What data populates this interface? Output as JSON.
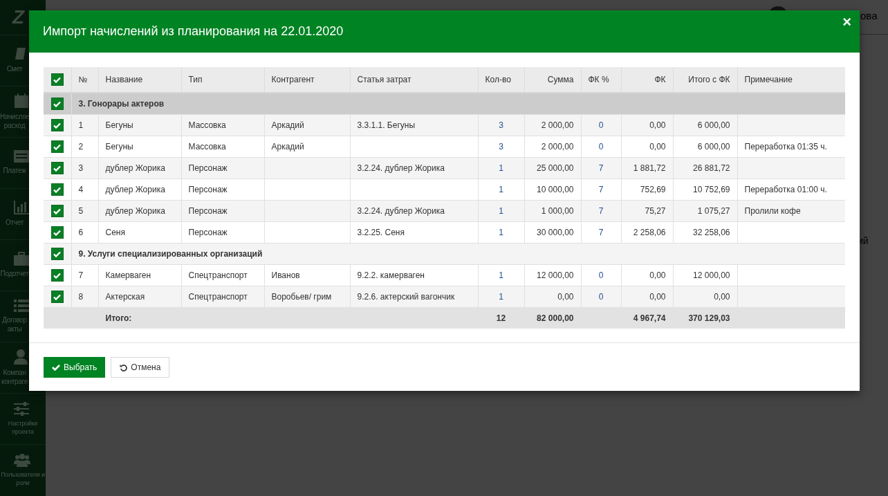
{
  "sidebar": {
    "logo": "Z",
    "items": [
      {
        "lines": [
          "Смет"
        ]
      },
      {
        "lines": [
          "Начисляе",
          "расход"
        ]
      },
      {
        "lines": [
          "Платеж"
        ]
      },
      {
        "lines": [
          "Отчет"
        ]
      },
      {
        "lines": [
          "Подотчет"
        ]
      },
      {
        "lines": [
          "Договор",
          "акты"
        ]
      },
      {
        "lines": [
          "Компан",
          "контраге"
        ]
      },
      {
        "lines": [
          "Настройки",
          "проекта"
        ]
      },
      {
        "lines": [
          "Пользователи и",
          "роли"
        ]
      }
    ]
  },
  "top_bar": {
    "user_name": "ова"
  },
  "background": {
    "hint": "ий"
  },
  "dialog": {
    "title": "Импорт начислений из планирования на 22.01.2020",
    "close": "×",
    "table": {
      "header_checked": true,
      "columns": [
        "№",
        "Название",
        "Тип",
        "Контрагент",
        "Статья затрат",
        "Кол-во",
        "Сумма",
        "ФК %",
        "ФК",
        "Итого с ФК",
        "Примечание"
      ],
      "rows": [
        {
          "kind": "group",
          "checked": true,
          "highlighted": true,
          "title": "3. Гонорары актеров"
        },
        {
          "kind": "item",
          "checked": true,
          "cells": [
            "1",
            "Бегуны",
            "Массовка",
            "Аркадий",
            "3.3.1.1. Бегуны",
            "3",
            "2 000,00",
            "0",
            "0,00",
            "6 000,00",
            ""
          ]
        },
        {
          "kind": "item",
          "checked": true,
          "cells": [
            "2",
            "Бегуны",
            "Массовка",
            "Аркадий",
            "",
            "3",
            "2 000,00",
            "0",
            "0,00",
            "6 000,00",
            "Переработка 01:35 ч."
          ]
        },
        {
          "kind": "item",
          "checked": true,
          "cells": [
            "3",
            "дублер Жорика",
            "Персонаж",
            "",
            "3.2.24. дублер Жорика",
            "1",
            "25 000,00",
            "7",
            "1 881,72",
            "26 881,72",
            ""
          ]
        },
        {
          "kind": "item",
          "checked": true,
          "cells": [
            "4",
            "дублер Жорика",
            "Персонаж",
            "",
            "",
            "1",
            "10 000,00",
            "7",
            "752,69",
            "10 752,69",
            "Переработка 01:00 ч."
          ]
        },
        {
          "kind": "item",
          "checked": true,
          "cells": [
            "5",
            "дублер Жорика",
            "Персонаж",
            "",
            "3.2.24. дублер Жорика",
            "1",
            "1 000,00",
            "7",
            "75,27",
            "1 075,27",
            "Пролили кофе"
          ]
        },
        {
          "kind": "item",
          "checked": true,
          "cells": [
            "6",
            "Сеня",
            "Персонаж",
            "",
            "3.2.25. Сеня",
            "1",
            "30 000,00",
            "7",
            "2 258,06",
            "32 258,06",
            ""
          ]
        },
        {
          "kind": "group",
          "checked": true,
          "highlighted": false,
          "title": "9. Услуги специализированных организаций"
        },
        {
          "kind": "item",
          "checked": true,
          "cells": [
            "7",
            "Камерваген",
            "Спецтранспорт",
            "Иванов",
            "9.2.2. камерваген",
            "1",
            "12 000,00",
            "0",
            "0,00",
            "12 000,00",
            ""
          ]
        },
        {
          "kind": "item",
          "checked": true,
          "cells": [
            "8",
            "Актерская",
            "Спецтранспорт",
            "Воробьев/ грим",
            "9.2.6. актерский вагончик",
            "1",
            "0,00",
            "0",
            "0,00",
            "0,00",
            ""
          ]
        }
      ],
      "totals": {
        "label": "Итого:",
        "cells": [
          "12",
          "82 000,00",
          "",
          "4 967,74",
          "370 129,03",
          ""
        ]
      }
    },
    "buttons": [
      {
        "kind": "primary",
        "label": "Выбрать"
      },
      {
        "kind": "secondary",
        "label": "Отмена"
      }
    ]
  }
}
